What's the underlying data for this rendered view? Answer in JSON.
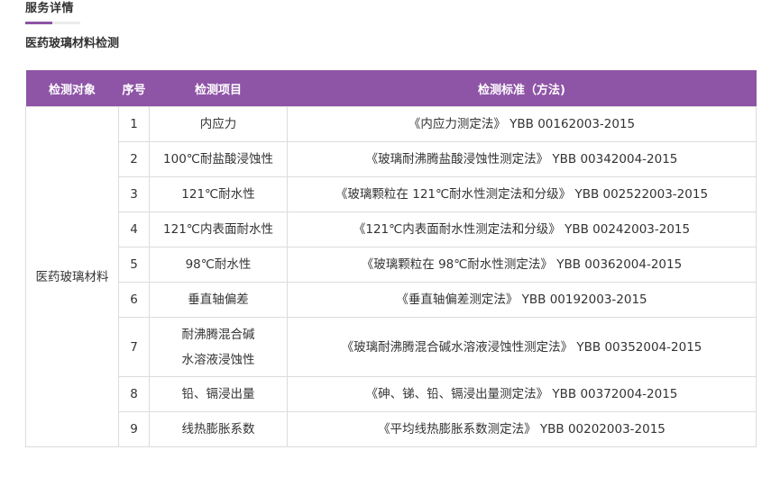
{
  "header": {
    "tab_title": "服务详情",
    "accent_color": "#8e54a6"
  },
  "section": {
    "title": "医药玻璃材料检测"
  },
  "table": {
    "headers": [
      "检测对象",
      "序号",
      "检测项目",
      "检测标准（方法)"
    ],
    "object": "医药玻璃材料",
    "rows": [
      {
        "no": "1",
        "item": "内应力",
        "standard": "《内应力测定法》 YBB 00162003-2015"
      },
      {
        "no": "2",
        "item": "100℃耐盐酸浸蚀性",
        "standard": "《玻璃耐沸腾盐酸浸蚀性测定法》 YBB 00342004-2015"
      },
      {
        "no": "3",
        "item": "121℃耐水性",
        "standard": "《玻璃颗粒在 121℃耐水性测定法和分级》 YBB 002522003-2015"
      },
      {
        "no": "4",
        "item": "121℃内表面耐水性",
        "standard": "《121℃内表面耐水性测定法和分级》 YBB 00242003-2015"
      },
      {
        "no": "5",
        "item": "98℃耐水性",
        "standard": "《玻璃颗粒在 98℃耐水性测定法》 YBB 00362004-2015"
      },
      {
        "no": "6",
        "item": "垂直轴偏差",
        "standard": "《垂直轴偏差测定法》 YBB 00192003-2015"
      },
      {
        "no": "7",
        "item_line1": "耐沸腾混合碱",
        "item_line2": "水溶液浸蚀性",
        "standard": "《玻璃耐沸腾混合碱水溶液浸蚀性测定法》 YBB 00352004-2015"
      },
      {
        "no": "8",
        "item": "铅、镉浸出量",
        "standard": "《砷、锑、铅、镉浸出量测定法》 YBB 00372004-2015"
      },
      {
        "no": "9",
        "item": "线热膨胀系数",
        "standard": "《平均线热膨胀系数测定法》 YBB 00202003-2015"
      }
    ]
  }
}
